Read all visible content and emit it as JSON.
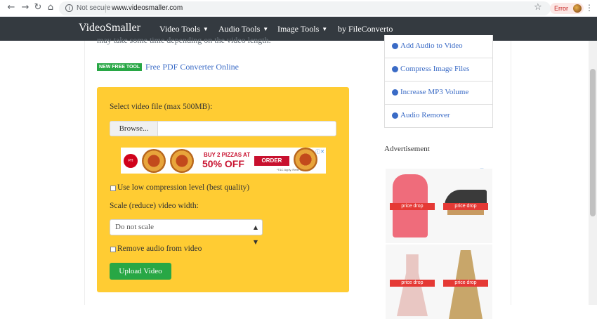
{
  "browser": {
    "security_label": "Not secure",
    "url": "www.videosmaller.com",
    "error_label": "Error",
    "icons": [
      "back-icon",
      "forward-icon",
      "reload-icon",
      "home-icon",
      "info-icon",
      "star-icon",
      "menu-kebab-icon"
    ]
  },
  "site": {
    "brand": "VideoSmaller",
    "menu": [
      {
        "label": "Video Tools",
        "has_dropdown": true
      },
      {
        "label": "Audio Tools",
        "has_dropdown": true
      },
      {
        "label": "Image Tools",
        "has_dropdown": true
      },
      {
        "label": "by FileConverto",
        "has_dropdown": false
      }
    ]
  },
  "main": {
    "cut_text": "may take some time depending on the video length.",
    "new_tool_badge": "NEW FREE TOOL",
    "pdf_link": "Free PDF Converter Online",
    "form": {
      "select_file_label": "Select video file (max 500MB):",
      "browse_label": "Browse...",
      "low_compression_label": "Use low compression level (best quality)",
      "scale_label": "Scale (reduce) video width:",
      "scale_selected": "Do not scale",
      "remove_audio_label": "Remove audio from video",
      "upload_label": "Upload Video"
    },
    "ad": {
      "line1": "BUY 2 PIZZAS AT",
      "line2": "50% OFF",
      "cta": "ORDER NOW",
      "fine_print": "*T&C Apply. Refer website."
    }
  },
  "sidebar": {
    "items": [
      {
        "label": "Add Audio to Video"
      },
      {
        "label": "Compress Image Files"
      },
      {
        "label": "Increase MP3 Volume"
      },
      {
        "label": "Audio Remover"
      }
    ],
    "advertisement_title": "Advertisement",
    "ad_tag": "price drop"
  },
  "colors": {
    "nav_bg": "#343a40",
    "form_bg": "#ffcc33",
    "accent_green": "#28a745",
    "link_blue": "#3a6bc6"
  }
}
